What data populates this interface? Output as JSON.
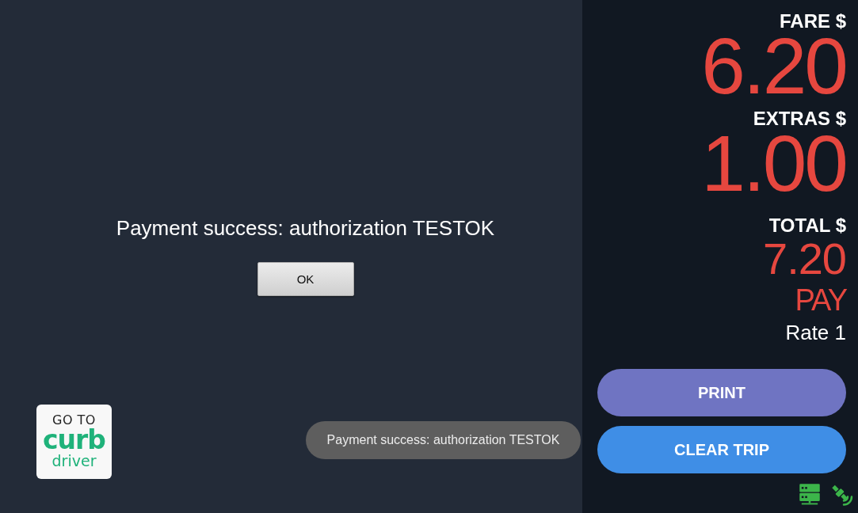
{
  "message": {
    "text": "Payment success: authorization TESTOK",
    "button": "OK"
  },
  "logo": {
    "line_1": "GO TO",
    "wordmark": "curb",
    "line_2": "driver"
  },
  "toast": {
    "text": "Payment success: authorization TESTOK"
  },
  "meter": {
    "readouts": [
      {
        "label": "FARE $",
        "value": "6.20",
        "kind": "large"
      },
      {
        "label": "EXTRAS $",
        "value": "1.00",
        "kind": "large"
      },
      {
        "label": "TOTAL $",
        "value": "7.20",
        "kind": "small"
      }
    ],
    "status": "PAY",
    "rate": "Rate 1"
  },
  "actions": [
    {
      "label": "PRINT",
      "color": "#6f74c2"
    },
    {
      "label": "CLEAR TRIP",
      "color": "#3f8ee6"
    }
  ]
}
